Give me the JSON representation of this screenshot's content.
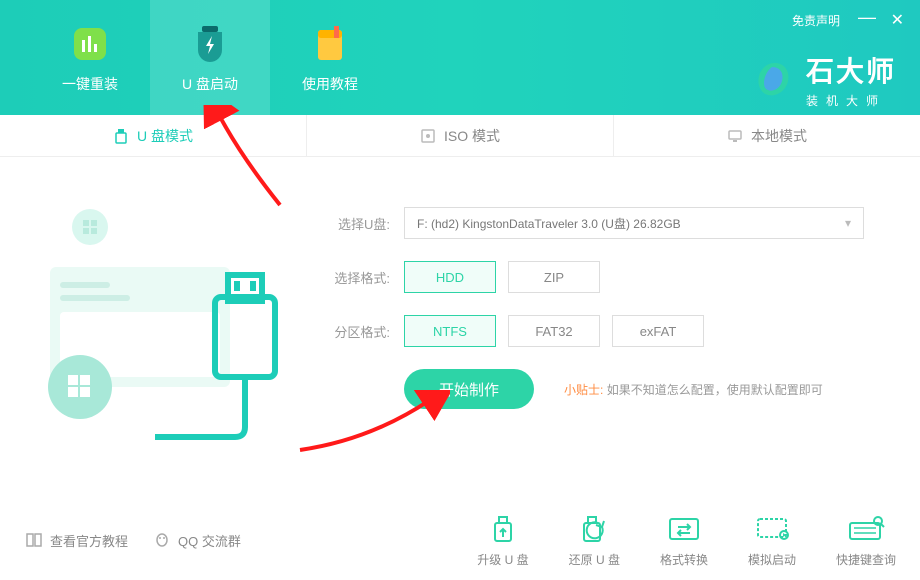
{
  "header": {
    "disclaimer": "免责声明",
    "tabs": {
      "reinstall": "一键重装",
      "usb_boot": "U 盘启动",
      "tutorial": "使用教程"
    },
    "brand": {
      "title": "石大师",
      "subtitle": "装机大师"
    }
  },
  "modes": {
    "usb": "U 盘模式",
    "iso": "ISO 模式",
    "local": "本地模式"
  },
  "form": {
    "select_usb_label": "选择U盘:",
    "select_usb_value": "F: (hd2) KingstonDataTraveler 3.0 (U盘) 26.82GB",
    "format_label": "选择格式:",
    "format_opts": {
      "hdd": "HDD",
      "zip": "ZIP"
    },
    "partition_label": "分区格式:",
    "partition_opts": {
      "ntfs": "NTFS",
      "fat32": "FAT32",
      "exfat": "exFAT"
    },
    "start_btn": "开始制作",
    "tip_label": "小贴士:",
    "tip_text": "如果不知道怎么配置，使用默认配置即可"
  },
  "footer": {
    "official_tutorial": "查看官方教程",
    "qq_group": "QQ 交流群",
    "tools": {
      "upgrade": "升级 U 盘",
      "restore": "还原 U 盘",
      "convert": "格式转换",
      "simulate": "模拟启动",
      "hotkey": "快捷键查询"
    }
  }
}
